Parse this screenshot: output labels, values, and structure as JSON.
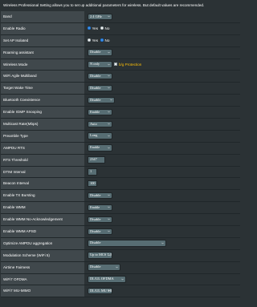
{
  "header": {
    "text": "Wireless Professional Setting allows you to set up additional parameters for wireless. But default values are recommended."
  },
  "rows": [
    {
      "label": "Band",
      "type": "select",
      "value": "2.4 GHz"
    },
    {
      "label": "Enable Radio",
      "type": "radio",
      "options": [
        {
          "label": "Yes",
          "checked": true
        },
        {
          "label": "No",
          "checked": false
        }
      ]
    },
    {
      "label": "Set AP Isolated",
      "type": "radio",
      "options": [
        {
          "label": "Yes",
          "checked": false
        },
        {
          "label": "No",
          "checked": true
        }
      ]
    },
    {
      "label": "Roaming assistant",
      "type": "select",
      "value": "Disable"
    },
    {
      "label": "Wireless Mode",
      "type": "select",
      "value": "N only",
      "checkbox_label": "b/g Protection",
      "checkbox_checked": false
    },
    {
      "label": "WiFi Agile Multiband",
      "type": "select",
      "value": "Disable"
    },
    {
      "label": "Target Wake Time",
      "type": "select",
      "value": "Disable"
    },
    {
      "label": "Bluetooth Coexistence",
      "type": "select",
      "value": "Disable"
    },
    {
      "label": "Enable IGMP Snooping",
      "type": "select",
      "value": "Enable"
    },
    {
      "label": "Multicast Rate(Mbps)",
      "type": "select",
      "value": "Auto"
    },
    {
      "label": "Preamble Type",
      "type": "select",
      "value": "Long"
    },
    {
      "label": "AMPDU RTS",
      "type": "select",
      "value": "Enable"
    },
    {
      "label": "RTS Threshold",
      "type": "text",
      "value": "2347"
    },
    {
      "label": "DTIM Interval",
      "type": "text",
      "value": "1"
    },
    {
      "label": "Beacon Interval",
      "type": "text",
      "value": "100"
    },
    {
      "label": "Enable TX Bursting",
      "type": "select",
      "value": "Disable"
    },
    {
      "label": "Enable WMM",
      "type": "select",
      "value": "Enable"
    },
    {
      "label": "Enable WMM No-Acknowledgement",
      "type": "select",
      "value": "Disable"
    },
    {
      "label": "Enable WMM APSD",
      "type": "select",
      "value": "Disable"
    },
    {
      "label": "Optimize AMPDU aggregation",
      "type": "select",
      "value": "Disable"
    },
    {
      "label": "Modulation Scheme (WiFi 5)",
      "type": "select",
      "value": "Up to MCS 7 (802.11n)"
    },
    {
      "label": "Airtime Fairness",
      "type": "select",
      "value": "Disable"
    },
    {
      "label": "WiFi7 OFDMA",
      "type": "select",
      "value": "DL/UL OFDMA"
    },
    {
      "label": "WiFi7 MU-MIMO",
      "type": "select",
      "value": "DL/UL MU MIMO"
    }
  ]
}
